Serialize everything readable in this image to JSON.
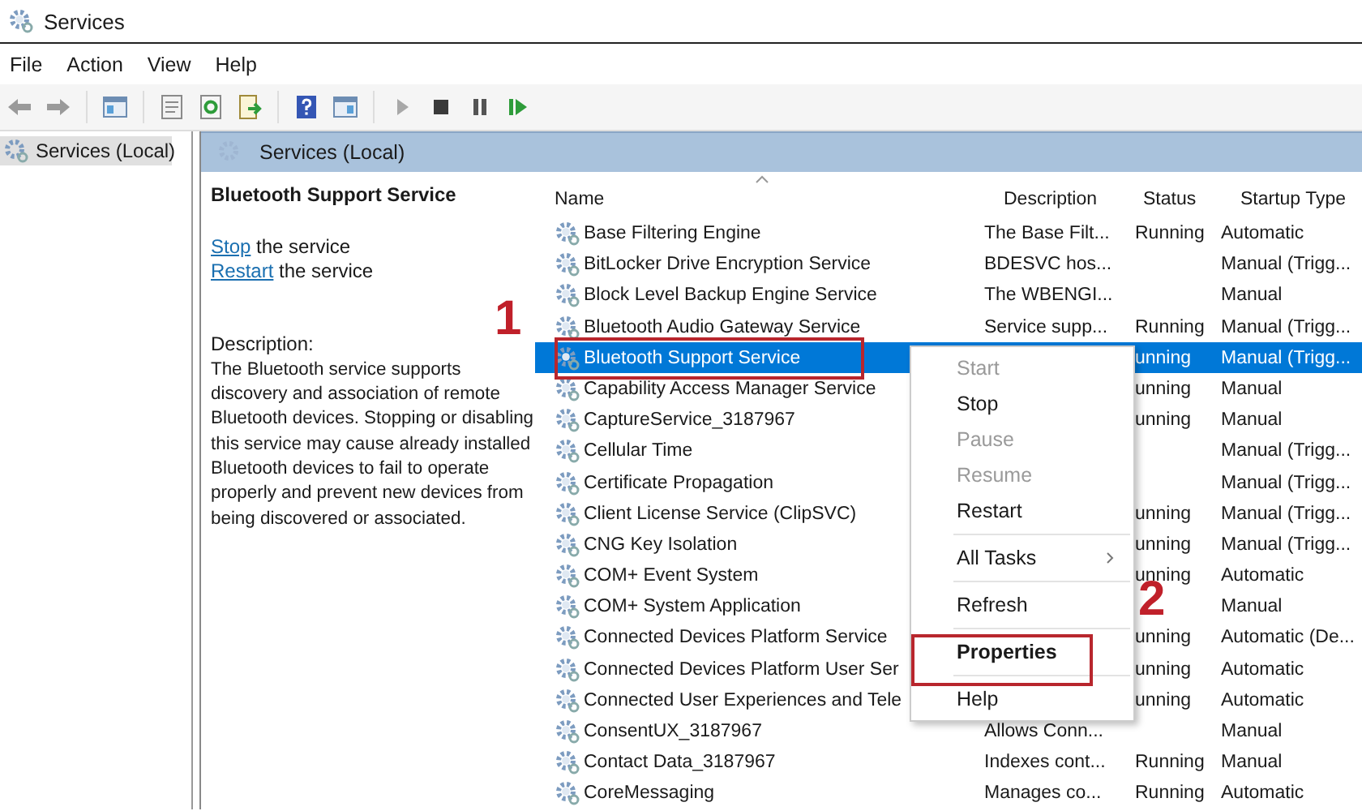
{
  "window": {
    "title": "Services"
  },
  "menu_bar": [
    "File",
    "Action",
    "View",
    "Help"
  ],
  "tree": {
    "items": [
      {
        "label": "Services (Local)",
        "selected": true
      }
    ]
  },
  "pane_header": "Services (Local)",
  "details": {
    "title": "Bluetooth Support Service",
    "actions": [
      {
        "link": "Stop",
        "text": "the service"
      },
      {
        "link": "Restart",
        "text": "the service"
      }
    ],
    "description_label": "Description:",
    "description": "The Bluetooth service supports discovery and association of remote Bluetooth devices.  Stopping or disabling this service may cause already installed Bluetooth devices to fail to operate properly and prevent new devices from being discovered or associated."
  },
  "table": {
    "columns": [
      "Name",
      "Description",
      "Status",
      "Startup Type"
    ],
    "rows": [
      {
        "name": "Base Filtering Engine",
        "description": "The Base Filt...",
        "status": "Running",
        "startup": "Automatic",
        "selected": false
      },
      {
        "name": "BitLocker Drive Encryption Service",
        "description": "BDESVC hos...",
        "status": "",
        "startup": "Manual (Trigg...",
        "selected": false
      },
      {
        "name": "Block Level Backup Engine Service",
        "description": "The WBENGI...",
        "status": "",
        "startup": "Manual",
        "selected": false
      },
      {
        "name": "Bluetooth Audio Gateway Service",
        "description": "Service supp...",
        "status": "Running",
        "startup": "Manual (Trigg...",
        "selected": false
      },
      {
        "name": "Bluetooth Support Service",
        "description": "",
        "status": "unning",
        "startup": "Manual (Trigg...",
        "selected": true
      },
      {
        "name": "Capability Access Manager Service",
        "description": "",
        "status": "unning",
        "startup": "Manual",
        "selected": false
      },
      {
        "name": "CaptureService_3187967",
        "description": "",
        "status": "unning",
        "startup": "Manual",
        "selected": false
      },
      {
        "name": "Cellular Time",
        "description": "",
        "status": "",
        "startup": "Manual (Trigg...",
        "selected": false
      },
      {
        "name": "Certificate Propagation",
        "description": "",
        "status": "",
        "startup": "Manual (Trigg...",
        "selected": false
      },
      {
        "name": "Client License Service (ClipSVC)",
        "description": "",
        "status": "unning",
        "startup": "Manual (Trigg...",
        "selected": false
      },
      {
        "name": "CNG Key Isolation",
        "description": "",
        "status": "unning",
        "startup": "Manual (Trigg...",
        "selected": false
      },
      {
        "name": "COM+ Event System",
        "description": "",
        "status": "unning",
        "startup": "Automatic",
        "selected": false
      },
      {
        "name": "COM+ System Application",
        "description": "",
        "status": "",
        "startup": "Manual",
        "selected": false
      },
      {
        "name": "Connected Devices Platform Service",
        "description": "",
        "status": "unning",
        "startup": "Automatic (De...",
        "selected": false
      },
      {
        "name": "Connected Devices Platform User Ser",
        "description": "",
        "status": "unning",
        "startup": "Automatic",
        "selected": false
      },
      {
        "name": "Connected User Experiences and Tele",
        "description": "",
        "status": "unning",
        "startup": "Automatic",
        "selected": false
      },
      {
        "name": "ConsentUX_3187967",
        "description": "Allows Conn...",
        "status": "",
        "startup": "Manual",
        "selected": false
      },
      {
        "name": "Contact Data_3187967",
        "description": "Indexes cont...",
        "status": "Running",
        "startup": "Manual",
        "selected": false
      },
      {
        "name": "CoreMessaging",
        "description": "Manages co...",
        "status": "Running",
        "startup": "Automatic",
        "selected": false
      }
    ]
  },
  "context_menu": [
    {
      "kind": "item",
      "label": "Start",
      "disabled": true,
      "submenu": false,
      "default": false
    },
    {
      "kind": "item",
      "label": "Stop",
      "disabled": false,
      "submenu": false,
      "default": false
    },
    {
      "kind": "item",
      "label": "Pause",
      "disabled": true,
      "submenu": false,
      "default": false
    },
    {
      "kind": "item",
      "label": "Resume",
      "disabled": true,
      "submenu": false,
      "default": false
    },
    {
      "kind": "item",
      "label": "Restart",
      "disabled": false,
      "submenu": false,
      "default": false
    },
    {
      "kind": "separator"
    },
    {
      "kind": "item",
      "label": "All Tasks",
      "disabled": false,
      "submenu": true,
      "default": false
    },
    {
      "kind": "separator"
    },
    {
      "kind": "item",
      "label": "Refresh",
      "disabled": false,
      "submenu": false,
      "default": false
    },
    {
      "kind": "separator"
    },
    {
      "kind": "item",
      "label": "Properties",
      "disabled": false,
      "submenu": false,
      "default": true
    },
    {
      "kind": "separator"
    },
    {
      "kind": "item",
      "label": "Help",
      "disabled": false,
      "submenu": false,
      "default": false
    }
  ],
  "annotations": [
    {
      "number": "1"
    },
    {
      "number": "2"
    }
  ]
}
